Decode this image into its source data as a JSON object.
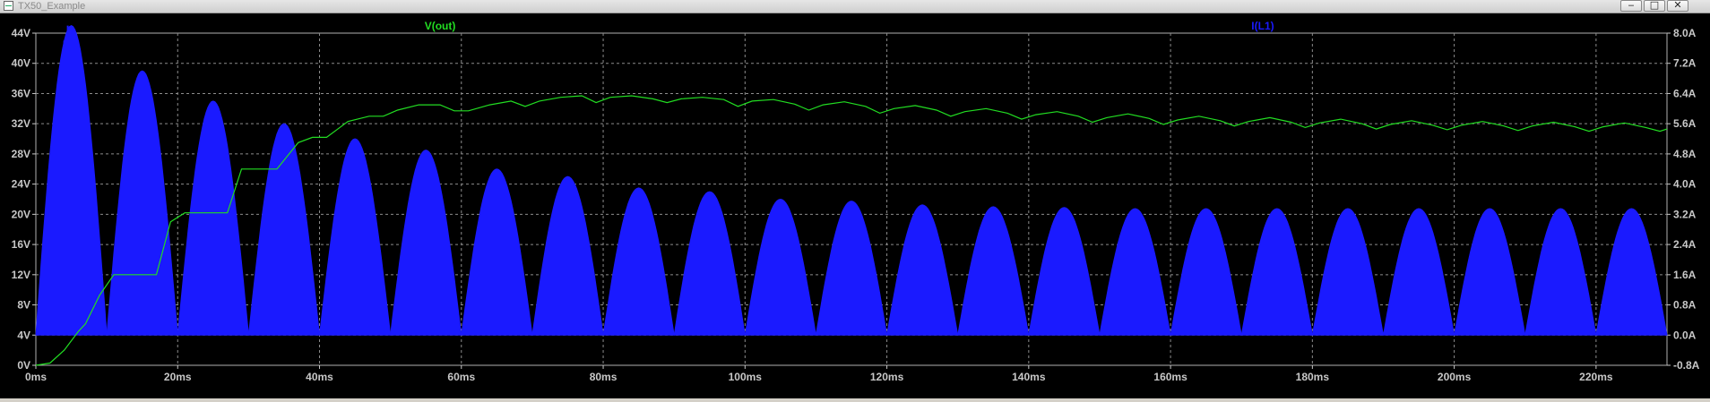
{
  "window": {
    "title": "TX50_Example",
    "min_symbol": "‒",
    "max_symbol": "□",
    "close_symbol": "✕"
  },
  "colors": {
    "background": "#000000",
    "grid": "#8c8c8c",
    "axis_text": "#c8c8c8",
    "vout": "#22dd22",
    "il1": "#1a1aff"
  },
  "chart_data": {
    "type": "line",
    "title": "",
    "x_axis": {
      "label": "",
      "unit": "ms",
      "range": [
        0,
        230
      ],
      "ticks": [
        "0ms",
        "20ms",
        "40ms",
        "60ms",
        "80ms",
        "100ms",
        "120ms",
        "140ms",
        "160ms",
        "180ms",
        "200ms",
        "220ms"
      ]
    },
    "y_axis_left": {
      "label": "",
      "unit": "V",
      "range": [
        0,
        44
      ],
      "ticks": [
        "0V",
        "4V",
        "8V",
        "12V",
        "16V",
        "20V",
        "24V",
        "28V",
        "32V",
        "36V",
        "40V",
        "44V"
      ]
    },
    "y_axis_right": {
      "label": "",
      "unit": "A",
      "range": [
        -0.8,
        8.0
      ],
      "ticks": [
        "-0.8A",
        "0.0A",
        "0.8A",
        "1.6A",
        "2.4A",
        "3.2A",
        "4.0A",
        "4.8A",
        "5.6A",
        "6.4A",
        "7.2A",
        "8.0A"
      ]
    },
    "grid": true,
    "legend_placement": "top",
    "series": [
      {
        "name": "V(out)",
        "axis": "left",
        "style": "line",
        "x": [
          0,
          2,
          4,
          6,
          7,
          9,
          11,
          14,
          17,
          19,
          21,
          24,
          27,
          29,
          31,
          34,
          37,
          39,
          41,
          44,
          47,
          49,
          51,
          54,
          57,
          59,
          61,
          64,
          67,
          69,
          71,
          74,
          77,
          79,
          81,
          84,
          87,
          89,
          91,
          94,
          97,
          99,
          101,
          104,
          107,
          109,
          111,
          114,
          117,
          119,
          121,
          124,
          127,
          129,
          131,
          134,
          137,
          139,
          141,
          144,
          147,
          149,
          151,
          154,
          157,
          159,
          161,
          164,
          167,
          169,
          171,
          174,
          177,
          179,
          181,
          184,
          187,
          189,
          191,
          194,
          197,
          199,
          201,
          204,
          207,
          209,
          211,
          214,
          217,
          219,
          221,
          224,
          227,
          229,
          230
        ],
        "y": [
          0,
          0.3,
          2,
          4.5,
          5.5,
          9.3,
          12,
          12,
          12,
          19,
          20.2,
          20.2,
          20.2,
          26,
          26,
          26,
          29.5,
          30.2,
          30.2,
          32.3,
          33,
          33,
          33.8,
          34.5,
          34.5,
          33.7,
          33.7,
          34.5,
          35,
          34.3,
          35,
          35.5,
          35.7,
          34.8,
          35.5,
          35.7,
          35.3,
          34.8,
          35.3,
          35.5,
          35.2,
          34.3,
          35,
          35.2,
          34.6,
          33.8,
          34.5,
          34.9,
          34.3,
          33.4,
          34,
          34.4,
          33.8,
          33,
          33.6,
          34,
          33.4,
          32.6,
          33.2,
          33.6,
          33,
          32.2,
          32.8,
          33.3,
          32.7,
          31.9,
          32.5,
          33,
          32.4,
          31.7,
          32.3,
          32.8,
          32.2,
          31.5,
          32.1,
          32.6,
          32,
          31.3,
          31.9,
          32.4,
          31.8,
          31.2,
          31.8,
          32.3,
          31.7,
          31.1,
          31.7,
          32.2,
          31.6,
          31,
          31.6,
          32.1,
          31.5,
          31,
          31.3
        ]
      },
      {
        "name": "I(L1)",
        "axis": "right",
        "style": "filled-rectified-pulses",
        "x": [
          0,
          5,
          15,
          25,
          35,
          45,
          55,
          65,
          75,
          85,
          95,
          105,
          115,
          125,
          135,
          145,
          155,
          165,
          175,
          185,
          195,
          205,
          215,
          225,
          230
        ],
        "y": [
          0,
          8.2,
          7.0,
          6.2,
          5.6,
          5.2,
          4.9,
          4.4,
          4.2,
          3.9,
          3.8,
          3.6,
          3.55,
          3.45,
          3.4,
          3.38,
          3.35,
          3.35,
          3.35,
          3.35,
          3.35,
          3.35,
          3.35,
          3.35,
          0
        ]
      }
    ]
  }
}
